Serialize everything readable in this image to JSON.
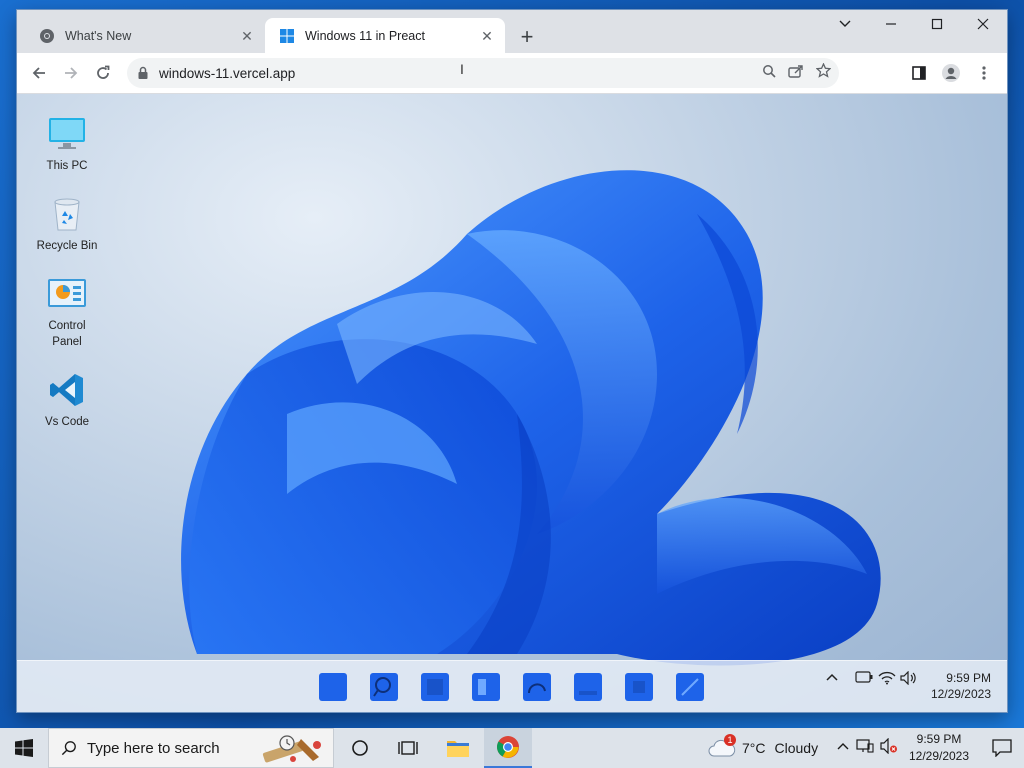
{
  "browser": {
    "tabs": [
      {
        "title": "What's New",
        "favicon": "chrome-icon"
      },
      {
        "title": "Windows 11 in Preact",
        "favicon": "windows-logo-icon",
        "active": true
      }
    ],
    "url": "windows-11.vercel.app",
    "window_controls": [
      "tab-search-icon",
      "minimize-icon",
      "maximize-icon",
      "close-icon"
    ],
    "toolbar_icons": [
      "back-icon",
      "forward-icon",
      "reload-icon",
      "zoom-icon",
      "share-icon",
      "bookmark-star-icon",
      "side-panel-icon",
      "profile-icon",
      "menu-icon"
    ]
  },
  "desktop": {
    "icons": [
      {
        "label": "This PC",
        "icon": "monitor-icon"
      },
      {
        "label": "Recycle Bin",
        "icon": "recycle-bin-icon"
      },
      {
        "label": "Control\nPanel",
        "icon": "control-panel-icon"
      },
      {
        "label": "Vs Code",
        "icon": "vscode-icon"
      }
    ],
    "taskbar": {
      "apps": [
        "start-icon",
        "search-icon",
        "widgets-icon",
        "settings-icon",
        "edge-icon",
        "explorer-icon",
        "store-icon",
        "app-icon"
      ],
      "time": "9:59 PM",
      "date": "12/29/2023"
    }
  },
  "host_taskbar": {
    "search_placeholder": "Type here to search",
    "weather": {
      "temp": "7°C",
      "condition": "Cloudy",
      "badge": "1"
    },
    "time": "9:59 PM",
    "date": "12/29/2023"
  },
  "colors": {
    "accent": "#1a73e8",
    "w11_blue": "#1e63e9",
    "tab_bar": "#dee1e6"
  }
}
